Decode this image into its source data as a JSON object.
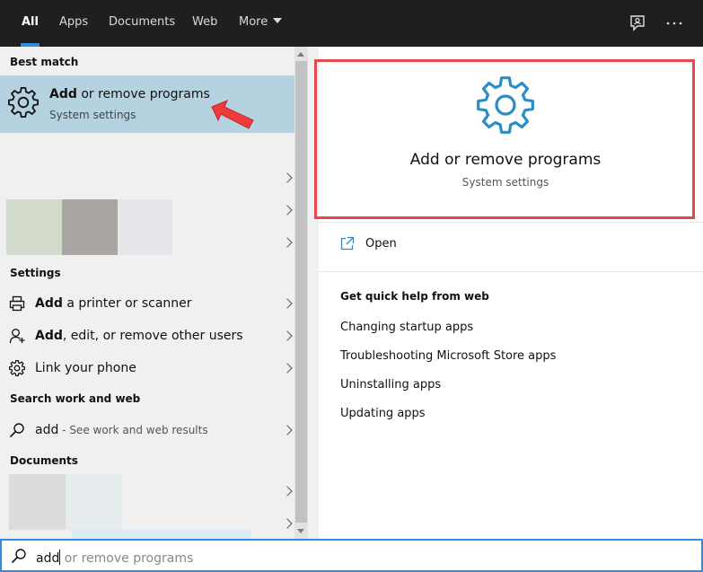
{
  "tabs": [
    {
      "label": "All",
      "active": true
    },
    {
      "label": "Apps",
      "active": false
    },
    {
      "label": "Documents",
      "active": false
    },
    {
      "label": "Web",
      "active": false
    },
    {
      "label": "More",
      "active": false
    }
  ],
  "top_icons": [
    "feedback-icon",
    "more-options-icon"
  ],
  "left": {
    "best_match_heading": "Best match",
    "best_match": {
      "title_bold": "Add",
      "title_rest": " or remove programs",
      "subtitle": "System settings",
      "icon": "gear-icon"
    },
    "settings_heading": "Settings",
    "settings": [
      {
        "bold": "Add",
        "rest": " a printer or scanner",
        "icon": "printer-icon"
      },
      {
        "bold": "Add",
        "rest": ", edit, or remove other users",
        "icon": "user-icon"
      },
      {
        "bold": "",
        "rest": "Link your phone",
        "icon": "gear-icon"
      }
    ],
    "search_web_heading": "Search work and web",
    "search_web": {
      "query": "add",
      "hint": " - See work and web results",
      "icon": "search-icon"
    },
    "documents_heading": "Documents"
  },
  "preview": {
    "title": "Add or remove programs",
    "subtitle": "System settings",
    "open_label": "Open",
    "help_heading": "Get quick help from web",
    "help_links": [
      "Changing startup apps",
      "Troubleshooting Microsoft Store apps",
      "Uninstalling apps",
      "Updating apps"
    ]
  },
  "search": {
    "typed": "add",
    "suggestion": " or remove programs"
  },
  "colors": {
    "accent": "#2f8ce0",
    "selection": "#b5d2e1",
    "highlight_box": "#e5484d",
    "topbar": "#1f1f1f",
    "icon_blue": "#2b8dc7"
  }
}
